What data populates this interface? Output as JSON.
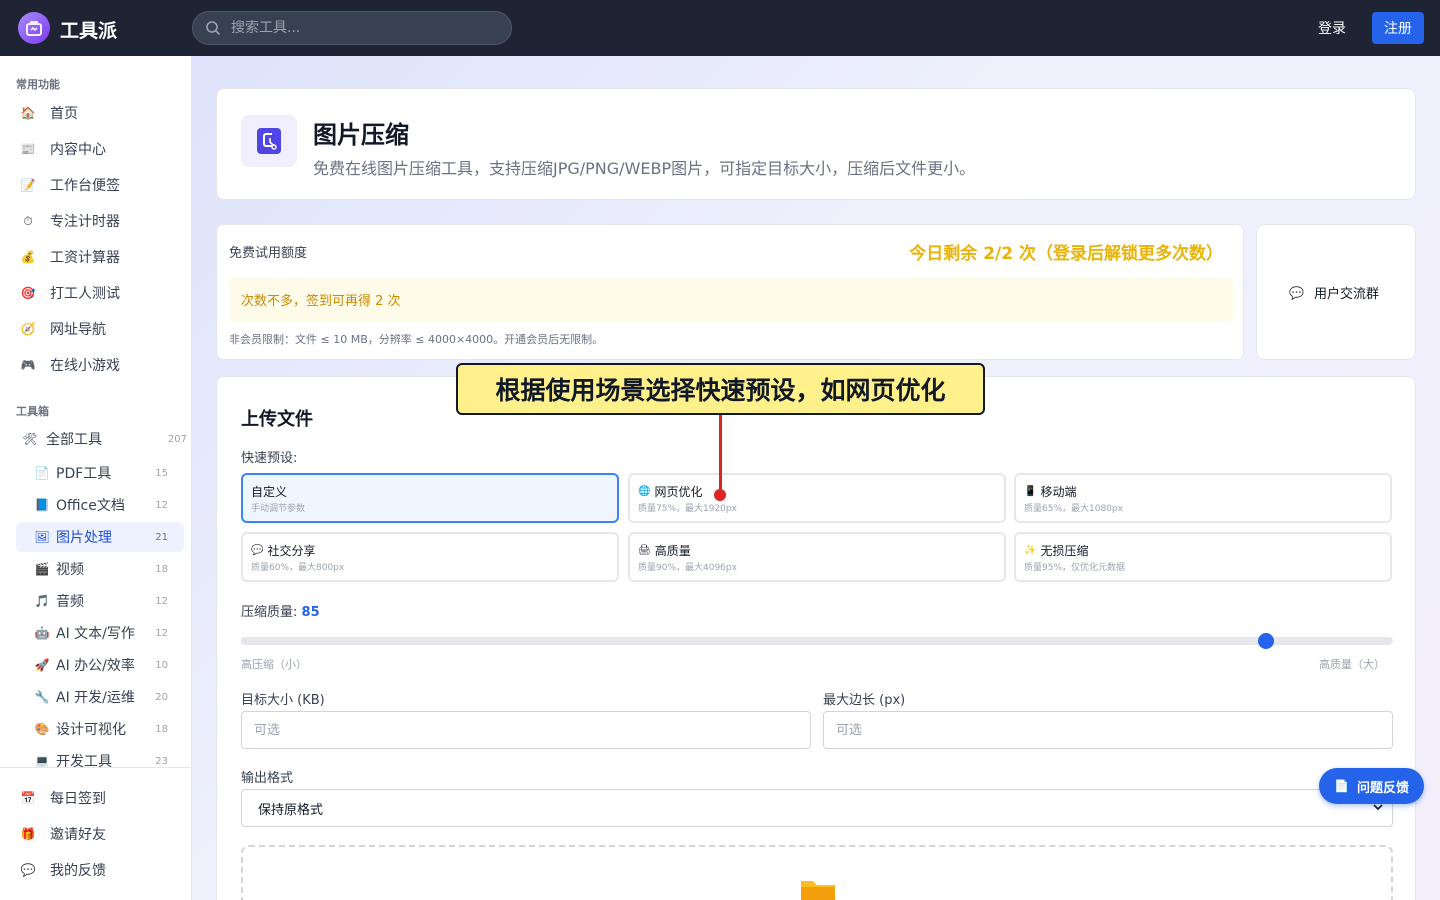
{
  "topbar": {
    "app_name": "工具派",
    "search_placeholder": "搜索工具...",
    "login_label": "登录",
    "register_label": "注册"
  },
  "sidebar": {
    "common_title": "常用功能",
    "common_items": [
      {
        "icon": "house-icon",
        "glyph": "🏠",
        "label": "首页"
      },
      {
        "icon": "newspaper-icon",
        "glyph": "📰",
        "label": "内容中心"
      },
      {
        "icon": "memo-icon",
        "glyph": "📝",
        "label": "工作台便签"
      },
      {
        "icon": "stopwatch-icon",
        "glyph": "⏱",
        "label": "专注计时器"
      },
      {
        "icon": "money-bag-icon",
        "glyph": "💰",
        "label": "工资计算器"
      },
      {
        "icon": "target-icon",
        "glyph": "🎯",
        "label": "打工人测试"
      },
      {
        "icon": "compass-icon",
        "glyph": "🧭",
        "label": "网址导航"
      },
      {
        "icon": "gamepad-icon",
        "glyph": "🎮",
        "label": "在线小游戏"
      }
    ],
    "toolbox_title": "工具箱",
    "all_tools": {
      "icon": "tools-icon",
      "glyph": "🛠",
      "label": "全部工具",
      "count": "207"
    },
    "tool_categories": [
      {
        "icon": "pdf-icon",
        "glyph": "📄",
        "label": "PDF工具",
        "count": "15"
      },
      {
        "icon": "office-doc-icon",
        "glyph": "📘",
        "label": "Office文档",
        "count": "12"
      },
      {
        "icon": "image-icon",
        "glyph": "🖼",
        "label": "图片处理",
        "count": "21",
        "active": true
      },
      {
        "icon": "video-icon",
        "glyph": "🎬",
        "label": "视频",
        "count": "18"
      },
      {
        "icon": "music-icon",
        "glyph": "🎵",
        "label": "音频",
        "count": "12"
      },
      {
        "icon": "robot-icon",
        "glyph": "🤖",
        "label": "AI 文本/写作",
        "count": "12"
      },
      {
        "icon": "rocket-icon",
        "glyph": "🚀",
        "label": "AI 办公/效率",
        "count": "10"
      },
      {
        "icon": "wrench-icon",
        "glyph": "🔧",
        "label": "AI 开发/运维",
        "count": "20"
      },
      {
        "icon": "palette-icon",
        "glyph": "🎨",
        "label": "设计可视化",
        "count": "18"
      },
      {
        "icon": "monitor-icon",
        "glyph": "💻",
        "label": "开发工具",
        "count": "23"
      }
    ],
    "bottom_items": [
      {
        "icon": "calendar-icon",
        "glyph": "📅",
        "label": "每日签到"
      },
      {
        "icon": "gift-icon",
        "glyph": "🎁",
        "label": "邀请好友"
      },
      {
        "icon": "speech-bubble-icon",
        "glyph": "💬",
        "label": "我的反馈"
      }
    ]
  },
  "header": {
    "title": "图片压缩",
    "description": "免费在线图片压缩工具，支持压缩JPG/PNG/WEBP图片，可指定目标大小，压缩后文件更小。"
  },
  "quota": {
    "label": "免费试用额度",
    "remaining": "今日剩余 2/2 次（登录后解锁更多次数）",
    "tip": "次数不多，签到可再得 2 次",
    "limit": "非会员限制：文件 ≤ 10 MB，分辨率 ≤ 4000×4000。开通会员后无限制。"
  },
  "community": {
    "label": "用户交流群"
  },
  "upload": {
    "title": "上传文件",
    "presets_label": "快速预设:",
    "presets": [
      {
        "icon": "none",
        "glyph": "",
        "name": "自定义",
        "desc": "手动调节参数",
        "active": true
      },
      {
        "icon": "globe-icon",
        "glyph": "🌐",
        "name": "网页优化",
        "desc": "质量75%，最大1920px"
      },
      {
        "icon": "mobile-icon",
        "glyph": "📱",
        "name": "移动端",
        "desc": "质量65%，最大1080px"
      },
      {
        "icon": "speech-bubble-icon",
        "glyph": "💬",
        "name": "社交分享",
        "desc": "质量60%，最大800px"
      },
      {
        "icon": "printer-icon",
        "glyph": "🖨",
        "name": "高质量",
        "desc": "质量90%，最大4096px"
      },
      {
        "icon": "sparkles-icon",
        "glyph": "✨",
        "name": "无损压缩",
        "desc": "质量95%，仅优化元数据"
      }
    ],
    "quality_label": "压缩质量:",
    "quality_value": "85",
    "quality_fraction": 0.89,
    "slider_min_label": "高压缩（小）",
    "slider_max_label": "高质量（大）",
    "target_size_label": "目标大小 (KB)",
    "target_size_placeholder": "可选",
    "max_edge_label": "最大边长 (px)",
    "max_edge_placeholder": "可选",
    "format_label": "输出格式",
    "format_value": "保持原格式"
  },
  "callout": {
    "text": "根据使用场景选择快速预设，如网页优化"
  },
  "feedback": {
    "label": "问题反馈"
  },
  "colors": {
    "accent": "#2563eb",
    "topbar": "#1e2433",
    "callout": "#fef08a",
    "warning": "#eab308"
  }
}
